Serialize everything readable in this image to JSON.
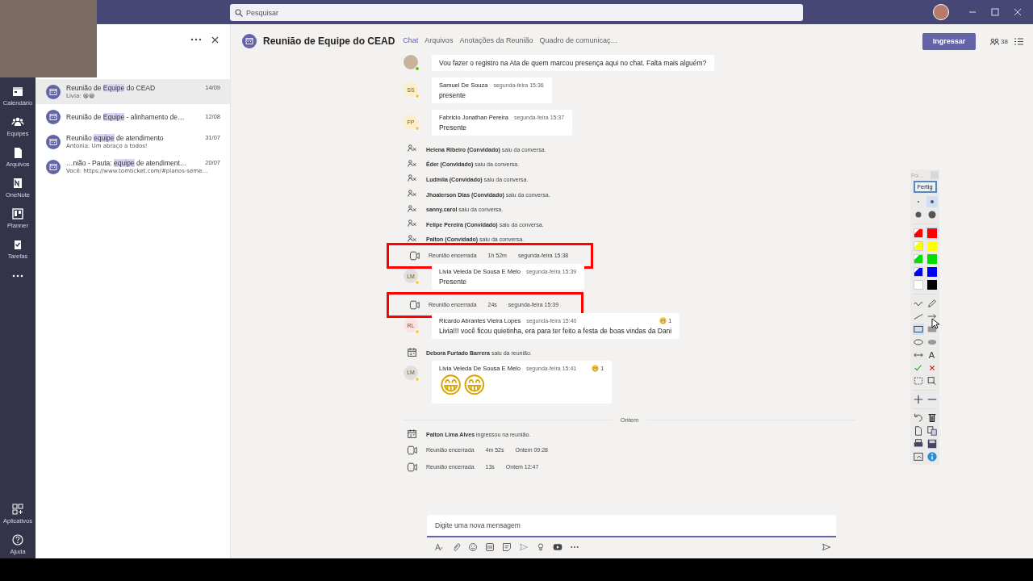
{
  "title_bar": {
    "search": {
      "placeholder": "Pesquisar"
    }
  },
  "app_bar": {
    "items": [
      {
        "label": "Calendário"
      },
      {
        "label": "Equipes"
      },
      {
        "label": "Arquivos"
      },
      {
        "label": "OneNote"
      },
      {
        "label": "Planner"
      },
      {
        "label": "Tarefas"
      }
    ],
    "bottom_items": [
      {
        "label": "Aplicativos"
      },
      {
        "label": "Ajuda"
      }
    ]
  },
  "chat_list": {
    "items": [
      {
        "title": [
          {
            "text": "Reunião de "
          },
          {
            "text": "Equipe",
            "highlight": true
          },
          {
            "text": " do CEAD"
          }
        ],
        "date": "14/09",
        "preview": "Livia: 😁😁",
        "selected": true
      },
      {
        "title": [
          {
            "text": "Reunião de "
          },
          {
            "text": "Equipe",
            "highlight": true
          },
          {
            "text": " - alinhamento de…"
          }
        ],
        "date": "12/08",
        "selected": false
      },
      {
        "title": [
          {
            "text": "Reunião "
          },
          {
            "text": "equipe",
            "highlight": true
          },
          {
            "text": " de atendimento"
          }
        ],
        "date": "31/07",
        "preview": "Antonia: Um abraço a todos!",
        "selected": false
      },
      {
        "title": [
          {
            "text": "…nião - Pauta: "
          },
          {
            "text": "equipe",
            "highlight": true
          },
          {
            "text": " de atendiment…"
          }
        ],
        "date": "20/07",
        "preview": "Você: https://www.tomticket.com/#planos-seme…",
        "selected": false
      }
    ]
  },
  "chat": {
    "title": "Reunião de Equipe do CEAD",
    "tabs": [
      {
        "label": "Chat",
        "selected": true
      },
      {
        "label": "Arquivos",
        "selected": false
      },
      {
        "label": "Anotações da Reunião",
        "selected": false
      },
      {
        "label": "Quadro de comunicaç…",
        "selected": false
      }
    ],
    "join_button": "Ingressar",
    "participants": "38",
    "timeline": [
      {
        "kind": "message",
        "away": false,
        "text": "Vou fazer o registro na Ata de quem marcou presença aqui no chat. Falta mais alguém?",
        "emoji_only": false
      },
      {
        "kind": "message",
        "initials": "SS",
        "color": "#fcefc7",
        "away": true,
        "author": "Samuel De Souza",
        "time": "segunda-feira 15:36",
        "text": "presente",
        "emoji_only": false
      },
      {
        "kind": "message",
        "initials": "FP",
        "color": "#fcefc7",
        "away": true,
        "author": "Fabricio Jonathan Pereira",
        "time": "segunda-feira 15:37",
        "text": "Presente",
        "emoji_only": false
      },
      {
        "kind": "left_chat",
        "text": "**Helena Ribeiro (Convidado)** saiu da conversa."
      },
      {
        "kind": "left_chat",
        "text": "**Éder (Convidado)** saiu da conversa."
      },
      {
        "kind": "left_chat",
        "text": "**Ludmila (Convidado)** saiu da conversa."
      },
      {
        "kind": "left_chat",
        "text": "**Jhoalerson Dias (Convidado)** saiu da conversa."
      },
      {
        "kind": "left_chat",
        "text": "**sanny.carol** saiu da conversa."
      },
      {
        "kind": "left_chat",
        "text": "**Felipe Pereira (Convidado)** saiu da conversa."
      },
      {
        "kind": "left_chat",
        "text": "**Palton (Convidado)** saiu da conversa."
      },
      {
        "kind": "meeting_ended",
        "label": "Reunião encerrada",
        "duration": "1h 52m",
        "time": "segunda-feira 15:38",
        "annotated": true
      },
      {
        "kind": "message",
        "initials": "LM",
        "color": "#e1dfdd",
        "away": true,
        "author": "Livia Veleda De Sousa E Melo",
        "time": "segunda-feira 15:39",
        "text": "Presente",
        "emoji_only": false
      },
      {
        "kind": "meeting_ended",
        "label": "Reunião encerrada",
        "duration": "24s",
        "time": "segunda-feira 15:39",
        "annotated": true
      },
      {
        "kind": "message",
        "initials": "RL",
        "color": "#fde2e2",
        "away": true,
        "author": "Ricardo Abrantes Vieira Lopes",
        "time": "segunda-feira 15:40",
        "text": "Livia!!! você ficou quietinha, era para ter feito a festa de boas vindas da Dani",
        "reaction": "1",
        "emoji_only": false
      },
      {
        "kind": "left_meeting",
        "text": "**Debora Furtado Barrera** saiu da reunião."
      },
      {
        "kind": "message",
        "initials": "LM",
        "color": "#e1dfdd",
        "away": true,
        "author": "Livia Veleda De Sousa E Melo",
        "time": "segunda-feira 15:41",
        "text": "😁😁",
        "reaction": "1",
        "emoji_only": true
      },
      {
        "kind": "date_divider",
        "label": "Ontem"
      },
      {
        "kind": "joined_meeting",
        "text": "**Palton Lima Alves** ingressou na reunião."
      },
      {
        "kind": "meeting_ended",
        "label": "Reunião encerrada",
        "duration": "4m 52s",
        "time": "Ontem 09:28",
        "annotated": false
      },
      {
        "kind": "meeting_ended",
        "label": "Reunião encerrada",
        "duration": "13s",
        "time": "Ontem 12:47",
        "annotated": false
      }
    ],
    "compose": {
      "placeholder": "Digite uma nova mensagem"
    }
  },
  "pen_toolbar": {
    "label": "Poi…",
    "done_button": "Fertig",
    "sizes": [
      {
        "kind": "small",
        "selected": false
      },
      {
        "kind": "medium",
        "selected": true
      },
      {
        "kind": "large",
        "selected": false
      },
      {
        "kind": "xlarge",
        "selected": false
      }
    ],
    "colors": [
      {
        "kind": "marker",
        "color": "#ff0000",
        "selected": false
      },
      {
        "kind": "pen",
        "color": "#ff0000",
        "selected": true
      },
      {
        "kind": "marker",
        "color": "#ffff00",
        "selected": false
      },
      {
        "kind": "pen",
        "color": "#ffff00",
        "selected": false
      },
      {
        "kind": "marker",
        "color": "#00e000",
        "selected": false
      },
      {
        "kind": "pen",
        "color": "#00e000",
        "selected": false
      },
      {
        "kind": "marker",
        "color": "#0000ff",
        "selected": false
      },
      {
        "kind": "pen",
        "color": "#0000ff",
        "selected": false
      },
      {
        "kind": "marker",
        "color": "#ffffff",
        "selected": false
      },
      {
        "kind": "pen",
        "color": "#000000",
        "selected": false
      }
    ],
    "tool_groups": [
      {
        "tools": [
          {
            "kind": "freehand",
            "selected": false
          },
          {
            "kind": "pencil",
            "selected": false
          },
          {
            "kind": "line",
            "selected": false
          },
          {
            "kind": "arrow",
            "selected": false
          },
          {
            "kind": "rectangle",
            "selected": true
          },
          {
            "kind": "filled_rectangle",
            "selected": false
          },
          {
            "kind": "ellipse",
            "selected": false
          },
          {
            "kind": "filled_ellipse",
            "selected": false
          },
          {
            "kind": "double_arrow",
            "selected": false
          },
          {
            "kind": "text",
            "label": "A",
            "selected": false
          },
          {
            "kind": "check",
            "selected": false
          },
          {
            "kind": "cross",
            "selected": false
          },
          {
            "kind": "select",
            "selected": false
          },
          {
            "kind": "zoom",
            "selected": false
          }
        ]
      },
      {
        "tools": [
          {
            "kind": "zoom_in",
            "selected": false
          },
          {
            "kind": "zoom_out",
            "selected": false
          }
        ]
      },
      {
        "tools": [
          {
            "kind": "undo",
            "selected": false
          },
          {
            "kind": "delete",
            "selected": false
          },
          {
            "kind": "new_page",
            "selected": false
          },
          {
            "kind": "copy",
            "selected": false
          },
          {
            "kind": "print",
            "selected": false
          },
          {
            "kind": "save",
            "selected": false
          },
          {
            "kind": "image",
            "selected": false
          },
          {
            "kind": "info",
            "selected": false
          }
        ]
      }
    ]
  }
}
